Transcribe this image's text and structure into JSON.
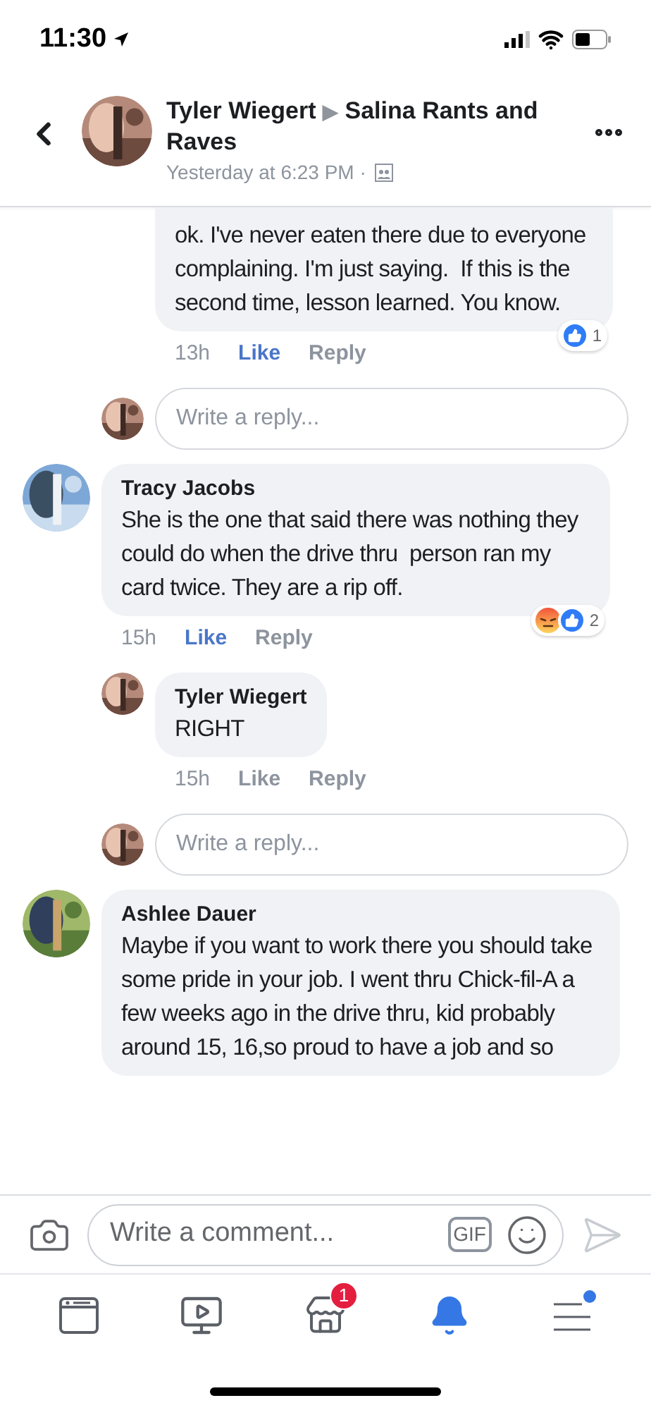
{
  "status_bar": {
    "time": "11:30"
  },
  "header": {
    "author": "Tyler Wiegert",
    "separator": "▶",
    "group": "Salina Rants and Raves",
    "timestamp": "Yesterday at 6:23 PM ·"
  },
  "feed": [
    {
      "kind": "reply",
      "text": "ok. I've never eaten there due to everyone complaining. I'm just saying.  If this is the second time, lesson learned. You know.",
      "time": "13h",
      "like": "Like",
      "liked": true,
      "reply": "Reply",
      "reactions": [
        {
          "kind": "like"
        }
      ],
      "reaction_count": "1"
    },
    {
      "kind": "reply_field",
      "placeholder": "Write a reply..."
    },
    {
      "kind": "comment",
      "author": "Tracy Jacobs",
      "text": "She is the one that said there was nothing they could do when the drive thru  person ran my card twice. They are a rip off.",
      "time": "15h",
      "like": "Like",
      "liked": true,
      "reply": "Reply",
      "reactions": [
        {
          "kind": "angry"
        },
        {
          "kind": "like"
        }
      ],
      "reaction_count": "2"
    },
    {
      "kind": "reply",
      "author": "Tyler Wiegert",
      "text": "RIGHT",
      "time": "15h",
      "like": "Like",
      "liked": false,
      "reply": "Reply"
    },
    {
      "kind": "reply_field",
      "placeholder": "Write a reply..."
    },
    {
      "kind": "comment",
      "author": "Ashlee Dauer",
      "text": "Maybe if you want to work there you should take some pride in your job. I went thru Chick-fil-A a few weeks ago in the drive thru, kid probably around 15, 16,so proud to have a job and so"
    }
  ],
  "composer": {
    "placeholder": "Write a comment...",
    "gif": "GIF"
  },
  "tabs": [
    {
      "kind": "feed",
      "selected": false
    },
    {
      "kind": "watch",
      "selected": false
    },
    {
      "kind": "marketplace",
      "selected": false,
      "badge": "1"
    },
    {
      "kind": "notifications",
      "selected": true
    },
    {
      "kind": "menu",
      "selected": false,
      "dot": true
    }
  ]
}
